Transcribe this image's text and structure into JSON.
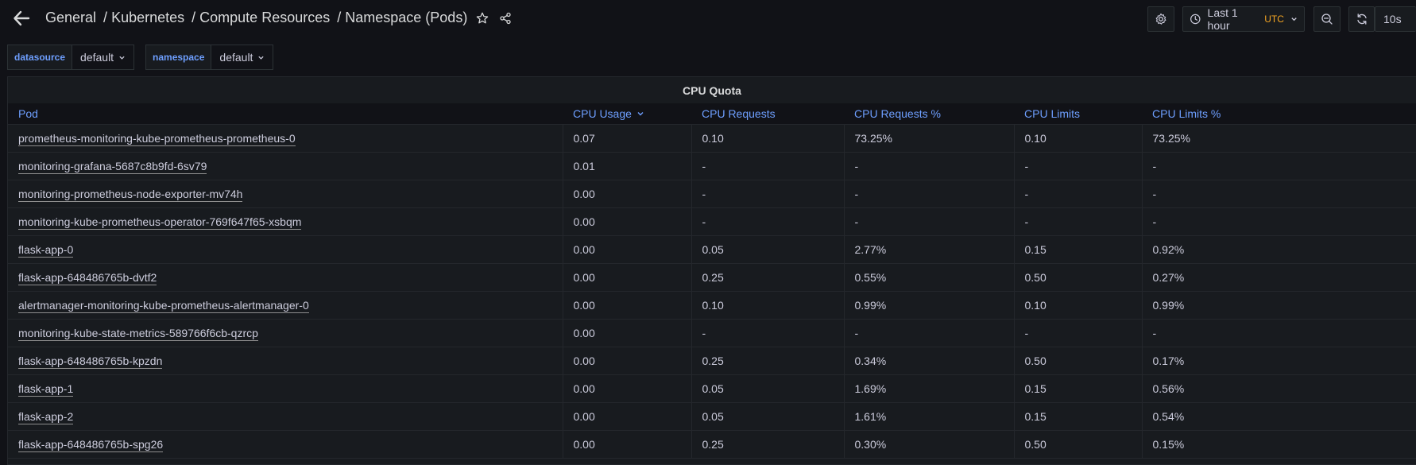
{
  "nav": {
    "breadcrumb": [
      "General",
      "Kubernetes",
      "Compute Resources",
      "Namespace (Pods)"
    ],
    "separator": "/"
  },
  "toolbar": {
    "time_range": "Last 1 hour",
    "timezone": "UTC",
    "refresh_interval": "10s"
  },
  "variables": [
    {
      "label": "datasource",
      "value": "default"
    },
    {
      "label": "namespace",
      "value": "default"
    }
  ],
  "panel": {
    "title": "CPU Quota",
    "columns": [
      "Pod",
      "CPU Usage",
      "CPU Requests",
      "CPU Requests %",
      "CPU Limits",
      "CPU Limits %"
    ],
    "sorted_column": "CPU Usage",
    "rows": [
      [
        "prometheus-monitoring-kube-prometheus-prometheus-0",
        "0.07",
        "0.10",
        "73.25%",
        "0.10",
        "73.25%"
      ],
      [
        "monitoring-grafana-5687c8b9fd-6sv79",
        "0.01",
        "-",
        "-",
        "-",
        "-"
      ],
      [
        "monitoring-prometheus-node-exporter-mv74h",
        "0.00",
        "-",
        "-",
        "-",
        "-"
      ],
      [
        "monitoring-kube-prometheus-operator-769f647f65-xsbqm",
        "0.00",
        "-",
        "-",
        "-",
        "-"
      ],
      [
        "flask-app-0",
        "0.00",
        "0.05",
        "2.77%",
        "0.15",
        "0.92%"
      ],
      [
        "flask-app-648486765b-dvtf2",
        "0.00",
        "0.25",
        "0.55%",
        "0.50",
        "0.27%"
      ],
      [
        "alertmanager-monitoring-kube-prometheus-alertmanager-0",
        "0.00",
        "0.10",
        "0.99%",
        "0.10",
        "0.99%"
      ],
      [
        "monitoring-kube-state-metrics-589766f6cb-qzrcp",
        "0.00",
        "-",
        "-",
        "-",
        "-"
      ],
      [
        "flask-app-648486765b-kpzdn",
        "0.00",
        "0.25",
        "0.34%",
        "0.50",
        "0.17%"
      ],
      [
        "flask-app-1",
        "0.00",
        "0.05",
        "1.69%",
        "0.15",
        "0.56%"
      ],
      [
        "flask-app-2",
        "0.00",
        "0.05",
        "1.61%",
        "0.15",
        "0.54%"
      ],
      [
        "flask-app-648486765b-spg26",
        "0.00",
        "0.25",
        "0.30%",
        "0.50",
        "0.15%"
      ]
    ]
  },
  "icons": {
    "back": "arrow-left-icon",
    "star": "star-icon",
    "share": "share-icon",
    "settings": "gear-icon",
    "clock": "clock-icon",
    "zoom_out": "zoom-out-icon",
    "refresh": "refresh-icon"
  },
  "colors": {
    "background": "#111217",
    "panel": "#181b1f",
    "header_link": "#6e9fff",
    "utc_badge": "#f5a623"
  }
}
